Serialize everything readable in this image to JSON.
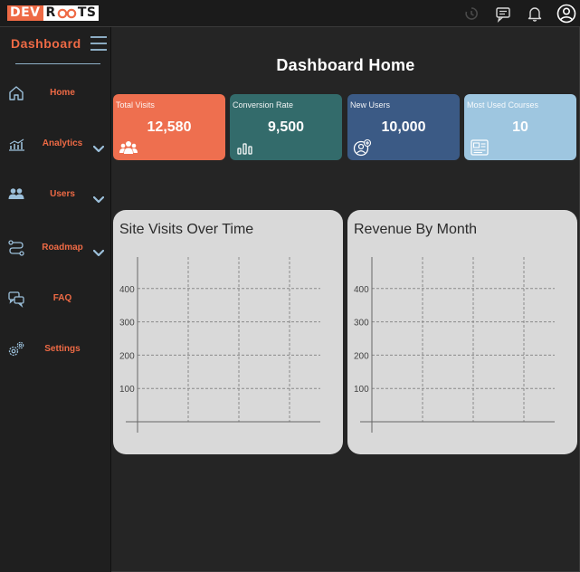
{
  "brand": {
    "part1": "DEV",
    "part2a": "R",
    "part2b": "TS"
  },
  "topbar_icons": [
    "history-icon",
    "chat-icon",
    "bell-icon",
    "user-circle-icon"
  ],
  "sidebar": {
    "title": "Dashboard",
    "items": [
      {
        "label": "Home",
        "icon": "home-icon",
        "has_chevron": false
      },
      {
        "label": "Analytics",
        "icon": "analytics-icon",
        "has_chevron": true
      },
      {
        "label": "Users",
        "icon": "users-icon",
        "has_chevron": true
      },
      {
        "label": "Roadmap",
        "icon": "roadmap-icon",
        "has_chevron": true
      },
      {
        "label": "FAQ",
        "icon": "faq-icon",
        "has_chevron": false
      },
      {
        "label": "Settings",
        "icon": "settings-icon",
        "has_chevron": false
      }
    ]
  },
  "main": {
    "title": "Dashboard Home",
    "cards": [
      {
        "label": "Total Visits",
        "value": "12,580",
        "icon": "users-group-icon",
        "color": "#ee6f4f"
      },
      {
        "label": "Conversion Rate",
        "value": "9,500",
        "icon": "bar-chart-icon",
        "color": "#336b6b"
      },
      {
        "label": "New Users",
        "value": "10,000",
        "icon": "add-user-icon",
        "color": "#3b5a85"
      },
      {
        "label": "Most Used Courses",
        "value": "10",
        "icon": "courses-icon",
        "color": "#9ec6e0"
      }
    ]
  },
  "colors": {
    "accent": "#ee6a45",
    "background": "#252525",
    "sidebar": "#1f1f1f",
    "chart_card": "#d9d9d9"
  },
  "chart_data": [
    {
      "type": "line",
      "title": "Site Visits Over Time",
      "xlabel": "",
      "ylabel": "",
      "yticks": [
        100,
        200,
        300,
        400
      ],
      "ylim": [
        0,
        450
      ],
      "series": [],
      "grid": true
    },
    {
      "type": "bar",
      "title": "Revenue By Month",
      "xlabel": "",
      "ylabel": "",
      "yticks": [
        100,
        200,
        300,
        400
      ],
      "ylim": [
        0,
        450
      ],
      "series": [],
      "grid": true
    }
  ]
}
